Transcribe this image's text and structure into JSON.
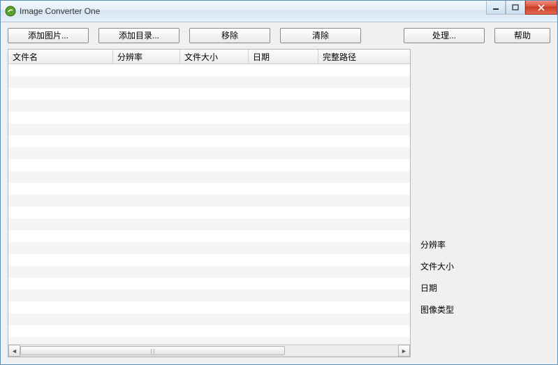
{
  "window": {
    "title": "Image Converter One"
  },
  "toolbar": {
    "add_image": "添加图片...",
    "add_dir": "添加目录...",
    "remove": "移除",
    "clear": "清除",
    "process": "处理...",
    "help": "帮助"
  },
  "columns": {
    "filename": "文件名",
    "resolution": "分辨率",
    "filesize": "文件大小",
    "date": "日期",
    "fullpath": "完整路径"
  },
  "column_widths": {
    "filename": 150,
    "resolution": 96,
    "filesize": 98,
    "date": 100,
    "fullpath": 100
  },
  "rows": [],
  "side": {
    "resolution_label": "分辨率",
    "filesize_label": "文件大小",
    "date_label": "日期",
    "imagetype_label": "图像类型"
  }
}
